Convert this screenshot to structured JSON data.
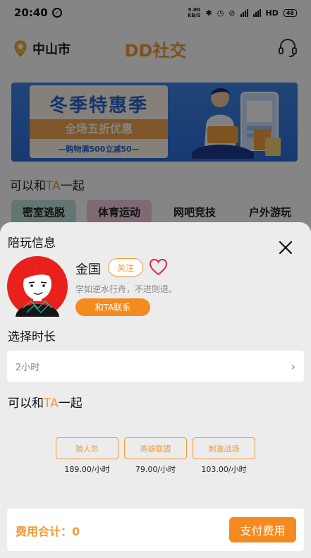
{
  "status_bar": {
    "time": "20:40",
    "network_speed_top": "5.00",
    "network_speed_bottom": "KB/S",
    "network_type": "HD",
    "battery": "48"
  },
  "header": {
    "city": "中山市",
    "app_title": "DD社交"
  },
  "banner": {
    "headline": "冬季特惠季",
    "ribbon": "全场五折优惠",
    "subline": "—购物满500立减50—"
  },
  "background_section": {
    "title_prefix": "可以和",
    "title_ta": "TA",
    "title_suffix": "一起",
    "categories": [
      {
        "label": "密室逃脱",
        "color": "#bfe3de"
      },
      {
        "label": "体育运动",
        "color": "#f5c9de"
      },
      {
        "label": "网吧竞技",
        "color": "#ffffff"
      },
      {
        "label": "户外游玩",
        "color": "#ffffff"
      }
    ]
  },
  "sheet": {
    "title": "陪玩信息",
    "user": {
      "name": "金国",
      "follow_label": "关注",
      "signature": "学如逆水行舟，不进则退。",
      "contact_label": "和TA联系"
    },
    "duration": {
      "title": "选择时长",
      "value": "2小时"
    },
    "games_title_prefix": "可以和",
    "games_title_ta": "TA",
    "games_title_suffix": "一起",
    "games": [
      {
        "name": "狼人杀",
        "price": "189.00/小时"
      },
      {
        "name": "英雄联盟",
        "price": "79.00/小时"
      },
      {
        "name": "刺激战场",
        "price": "103.00/小时"
      }
    ],
    "footer": {
      "total_label": "费用合计：",
      "total_value": "0",
      "pay_label": "支付费用"
    }
  },
  "colors": {
    "accent": "#f29a3a",
    "button": "#f58a1f"
  }
}
